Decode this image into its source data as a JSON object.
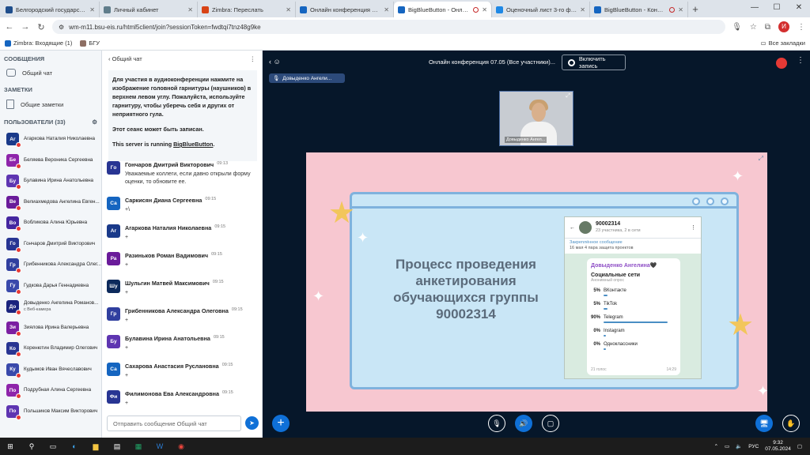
{
  "browser": {
    "tabs": [
      {
        "label": "Белгородский государственный",
        "color": "#1f4e8c"
      },
      {
        "label": "Личный кабинет",
        "color": "#607d8b"
      },
      {
        "label": "Zimbra: Переслать",
        "color": "#d84315"
      },
      {
        "label": "Онлайн конференция 07.05",
        "color": "#1565c0"
      },
      {
        "label": "BigBlueButton - Онлайн ко",
        "color": "#1565c0",
        "active": true,
        "recording": true
      },
      {
        "label": "Оценочный лист 3-го финал",
        "color": "#1e88e5"
      },
      {
        "label": "BigBlueButton - Конферен",
        "color": "#1565c0",
        "recording": true
      }
    ],
    "url": "wm-m11.bsu-eis.ru/html5client/join?sessionToken=fwdtqi7tnz48g9ke",
    "profile_initial": "И",
    "bookmarks": [
      "Zimbra: Входящие (1)",
      "БГУ"
    ],
    "all_bookmarks": "Все закладки"
  },
  "sidebar": {
    "messages_title": "СООБЩЕНИЯ",
    "public_chat": "Общий чат",
    "notes_title": "ЗАМЕТКИ",
    "shared_notes": "Общие заметки",
    "users_title": "ПОЛЬЗОВАТЕЛИ (33)",
    "users": [
      {
        "initials": "Аг",
        "name": "Агаркова Наталия Николаевна",
        "color": "#1a3a8a"
      },
      {
        "initials": "Бе",
        "name": "Беляева Вероника Сергеевна",
        "color": "#8e24aa"
      },
      {
        "initials": "Бу",
        "name": "Булавина Ирина Анатольевна",
        "color": "#5e35b1"
      },
      {
        "initials": "Ве",
        "name": "Велиахмедова Ангелина Евген...",
        "color": "#6a1b9a"
      },
      {
        "initials": "Во",
        "name": "Вобликова Алина Юрьевна",
        "color": "#4527a0"
      },
      {
        "initials": "Го",
        "name": "Гончаров Дмитрий Викторович",
        "color": "#283593"
      },
      {
        "initials": "Гр",
        "name": "Грибенникова Александра Олег...",
        "color": "#303f9f"
      },
      {
        "initials": "Гу",
        "name": "Гудкова Дарья Геннадиевна",
        "color": "#3949ab"
      },
      {
        "initials": "До",
        "name": "Довыденко Ангелина Романов...",
        "sub": "с Веб-камера",
        "color": "#1a237e"
      },
      {
        "initials": "Зи",
        "name": "Зиялова Ирина Валерьевна",
        "color": "#7b1fa2"
      },
      {
        "initials": "Ко",
        "name": "Коренютин Владимир Олегович",
        "color": "#283593"
      },
      {
        "initials": "Ку",
        "name": "Кудымов Иван Вячеславович",
        "color": "#3949ab"
      },
      {
        "initials": "По",
        "name": "Подрубная Алина Сергеевна",
        "color": "#8e24aa"
      },
      {
        "initials": "По",
        "name": "Польшиков Максим Викторович",
        "color": "#5e35b1"
      }
    ]
  },
  "chat": {
    "title": "Общий чат",
    "welcome_line1": "Для участия в аудиоконференции нажмите на изображение головной гарнитуры (наушников) в верхнем левом углу.",
    "welcome_bold": "Пожалуйста, используйте гарнитуру, чтобы уберечь себя и других от неприятного гула",
    "welcome_bold_end": ".",
    "record_notice": "Этот сеанс может быть записан.",
    "server_prefix": "This server is running ",
    "server_link": "BigBlueButton",
    "server_suffix": ".",
    "messages": [
      {
        "initials": "Гo",
        "author": "Гончаров Дмитрий Викторович",
        "time": "09:13",
        "text": "Уважаемые коллеги, если давно открыли форму оценки, то обновите ее.",
        "color": "#283593"
      },
      {
        "initials": "Са",
        "author": "Саркисян Диана Сергеевна",
        "time": "09:15",
        "text": "+\\",
        "color": "#1565c0"
      },
      {
        "initials": "Аг",
        "author": "Агаркова Наталия Николаевна",
        "time": "09:15",
        "text": "+",
        "color": "#1a3a8a"
      },
      {
        "initials": "Ра",
        "author": "Разиньков Роман Вадимович",
        "time": "09:15",
        "text": "+",
        "color": "#6a1b9a"
      },
      {
        "initials": "Шу",
        "author": "Шульгин Матвей Максимович",
        "time": "09:15",
        "text": "+",
        "color": "#0d2a5c"
      },
      {
        "initials": "Гр",
        "author": "Грибенникова Александра Олеговна",
        "time": "09:15",
        "text": "+",
        "color": "#303f9f"
      },
      {
        "initials": "Бу",
        "author": "Булавина Ирина Анатольевна",
        "time": "09:15",
        "text": "+",
        "color": "#5e35b1"
      },
      {
        "initials": "Са",
        "author": "Сахарова Анастасия Руслановна",
        "time": "09:15",
        "text": "+",
        "color": "#1565c0"
      },
      {
        "initials": "Фи",
        "author": "Филимонова Ева Александровна",
        "time": "09:15",
        "text": "+",
        "color": "#283593"
      }
    ],
    "input_placeholder": "Отправить сообщение Общий чат"
  },
  "main": {
    "title": "Онлайн конференция 07.05 (Все участники)...",
    "record_label": "Включить запись",
    "presenter": "Довыденко Ангели...",
    "webcam_label": "Довыденко Ангел...",
    "slide": {
      "heading": "Процесс проведения анкетирования обучающихся группы 90002314",
      "tg_title": "90002314",
      "tg_subtitle": "23 участника, 2 в сети",
      "tg_pinned": "Закреплённое сообщение",
      "tg_pinned_text": "16 мая 4 пара защита проектов",
      "poll_author": "Довыденко Ангелина🖤",
      "poll_question": "Социальные сети",
      "poll_kind": "Анонимный опрос",
      "poll_options": [
        {
          "pct": "5%",
          "label": "ВКонтакте",
          "fraction": 0.05
        },
        {
          "pct": "5%",
          "label": "TikTok",
          "fraction": 0.05
        },
        {
          "pct": "90%",
          "label": "Telegram",
          "fraction": 0.9
        },
        {
          "pct": "0%",
          "label": "Instagram",
          "fraction": 0
        },
        {
          "pct": "0%",
          "label": "Одноклассники",
          "fraction": 0
        }
      ],
      "poll_votes": "21 голос",
      "poll_time": "14:29"
    }
  },
  "taskbar": {
    "lang": "РУС",
    "time": "9:32",
    "date": "07.05.2024"
  }
}
